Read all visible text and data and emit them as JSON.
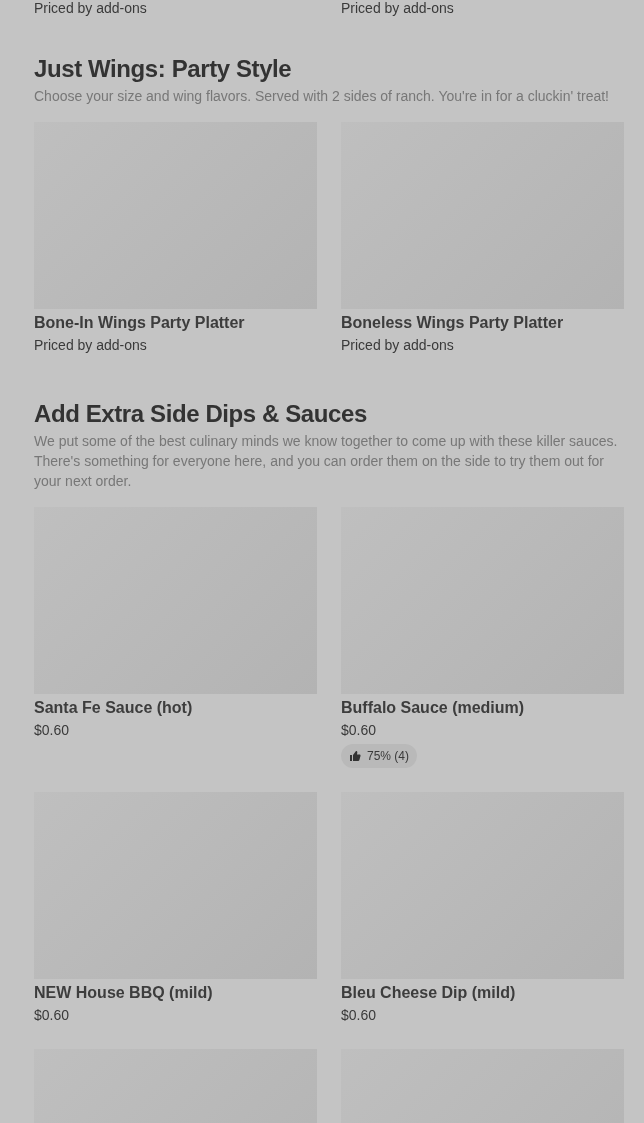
{
  "previous_section_items": [
    {
      "price": "Priced by add-ons"
    },
    {
      "price": "Priced by add-ons"
    }
  ],
  "sections": [
    {
      "title": "Just Wings: Party Style",
      "description": "Choose your size and wing flavors. Served with 2 sides of ranch. You're in for a cluckin' treat!",
      "items": [
        {
          "kind": "product",
          "name": "Bone-In Wings Party Platter",
          "price": "Priced by add-ons"
        },
        {
          "kind": "product",
          "name": "Boneless Wings Party Platter",
          "price": "Priced by add-ons"
        }
      ]
    },
    {
      "title": "Add Extra Side Dips & Sauces",
      "description": "We put some of the best culinary minds we know together to come up with these killer sauces. There's something for everyone here, and you can order them on the side to try them out for your next order.",
      "items": [
        {
          "kind": "product",
          "name": "Santa Fe Sauce (hot)",
          "price": "$0.60"
        },
        {
          "kind": "product",
          "name": "Buffalo Sauce (medium)",
          "price": "$0.60",
          "rating": "75% (4)"
        },
        {
          "kind": "product",
          "name": "NEW House BBQ (mild)",
          "price": "$0.60"
        },
        {
          "kind": "product",
          "name": "Bleu Cheese Dip (mild)",
          "price": "$0.60"
        },
        {
          "kind": "picture"
        },
        {
          "kind": "picture"
        }
      ]
    }
  ]
}
